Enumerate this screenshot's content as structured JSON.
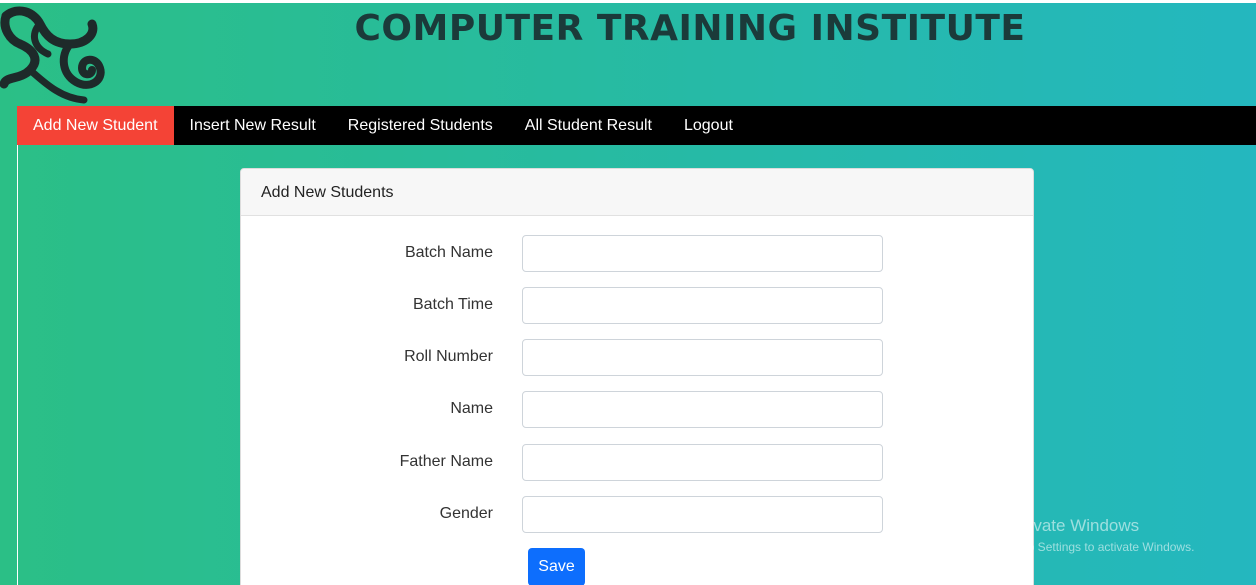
{
  "header": {
    "title": "COMPUTER TRAINING INSTITUTE",
    "logo_icon": "scroll-logo-icon"
  },
  "nav": {
    "items": [
      {
        "label": "Add New Student",
        "active": true
      },
      {
        "label": "Insert New Result",
        "active": false
      },
      {
        "label": "Registered Students",
        "active": false
      },
      {
        "label": "All Student Result",
        "active": false
      },
      {
        "label": "Logout",
        "active": false
      }
    ],
    "active_color": "#f44336",
    "bar_color": "#000000"
  },
  "card": {
    "title": "Add New Students",
    "fields": [
      {
        "label": "Batch Name",
        "value": ""
      },
      {
        "label": "Batch Time",
        "value": ""
      },
      {
        "label": "Roll Number",
        "value": ""
      },
      {
        "label": "Name",
        "value": ""
      },
      {
        "label": "Father Name",
        "value": ""
      },
      {
        "label": "Gender",
        "value": ""
      }
    ],
    "save_label": "Save",
    "save_color": "#0d6efd"
  },
  "watermark": {
    "title": "Activate Windows",
    "subtitle": "Go to Settings to activate Windows."
  }
}
